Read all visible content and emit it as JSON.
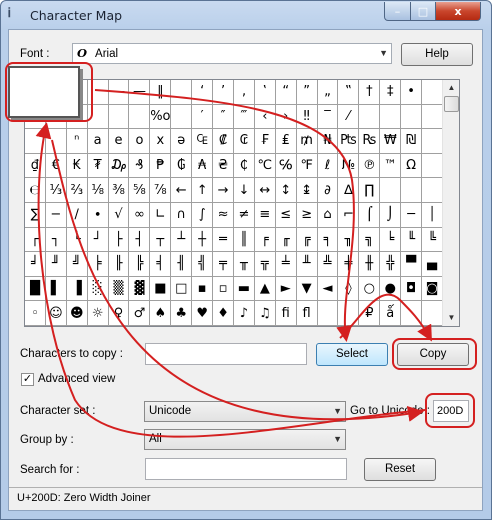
{
  "window": {
    "title": "Character Map",
    "app_icon": "character-map-icon",
    "minimize": "–",
    "maximize": "□",
    "close": "x"
  },
  "font": {
    "label": "Font :",
    "value": "Arial",
    "font_type_icon": "opentype-icon",
    "help_label": "Help"
  },
  "grid": {
    "rows": [
      [
        "",
        "",
        "",
        "",
        "—",
        "—",
        "‖",
        "_",
        "‘",
        "’",
        "‚",
        "‛",
        "“",
        "”",
        "„",
        "‟",
        "†",
        "‡",
        "•",
        ""
      ],
      [
        "",
        "",
        "",
        "",
        "",
        "",
        "%o",
        "",
        "′",
        "″",
        "‴",
        "‹",
        "›",
        "‼",
        "‾",
        "⁄",
        "",
        "",
        " ",
        ""
      ],
      [
        "",
        "",
        "ⁿ",
        "a",
        "e",
        "o",
        "x",
        "ə",
        "₠",
        "₡",
        "₢",
        "₣",
        "₤",
        "₥",
        "₦",
        "₧",
        "₨",
        "₩",
        "₪",
        ""
      ],
      [
        "₫",
        "€",
        "₭",
        "₮",
        "₯",
        "₰",
        "₱",
        "₲",
        "₳",
        "₴",
        "₵",
        "℃",
        "℅",
        "℉",
        "ℓ",
        "№",
        "℗",
        "™",
        "Ω",
        ""
      ],
      [
        "℮",
        "⅓",
        "⅔",
        "⅛",
        "⅜",
        "⅝",
        "⅞",
        "←",
        "↑",
        "→",
        "↓",
        "↔",
        "↕",
        "↨",
        "∂",
        "∆",
        "∏",
        "",
        "",
        " "
      ],
      [
        "∑",
        "−",
        "∕",
        "∙",
        "√",
        "∞",
        "∟",
        "∩",
        "∫",
        "≈",
        "≠",
        "≡",
        "≤",
        "≥",
        "⌂",
        "⌐",
        "⌠",
        "⌡",
        "─",
        "│"
      ],
      [
        "┌",
        "┐",
        "└",
        "┘",
        "├",
        "┤",
        "┬",
        "┴",
        "┼",
        "═",
        "║",
        "╒",
        "╓",
        "╔",
        "╕",
        "╖",
        "╗",
        "╘",
        "╙",
        "╚"
      ],
      [
        "╛",
        "╜",
        "╝",
        "╞",
        "╟",
        "╠",
        "╡",
        "╢",
        "╣",
        "╤",
        "╥",
        "╦",
        "╧",
        "╨",
        "╩",
        "╪",
        "╫",
        "╬",
        "▀",
        "▄"
      ],
      [
        "█",
        "▌",
        "▐",
        "░",
        "▒",
        "▓",
        "■",
        "□",
        "▪",
        "▫",
        "▬",
        "▲",
        "►",
        "▼",
        "◄",
        "◊",
        "○",
        "●",
        "◘",
        "◙"
      ],
      [
        "◦",
        "☺",
        "☻",
        "☼",
        "♀",
        "♂",
        "♠",
        "♣",
        "♥",
        "♦",
        "♪",
        "♫",
        "ﬁ",
        "ﬂ",
        "",
        "",
        "₽",
        "ǻ",
        "",
        ""
      ]
    ]
  },
  "copy": {
    "label": "Characters to copy :",
    "value": "",
    "select_label": "Select",
    "copy_label": "Copy"
  },
  "advanced": {
    "check_mark": "✓",
    "label": "Advanced view"
  },
  "charset": {
    "label": "Character set :",
    "value": "Unicode",
    "goto_label": "Go to Unicode :",
    "goto_value": "200D"
  },
  "group": {
    "label": "Group by :",
    "value": "All"
  },
  "search": {
    "label": "Search for :",
    "value": "",
    "reset_label": "Reset"
  },
  "status": {
    "text": "U+200D: Zero Width Joiner"
  },
  "colors": {
    "annotation": "#d42020",
    "title_bar": "#b9cfea",
    "select_button": "#bee6fd"
  }
}
